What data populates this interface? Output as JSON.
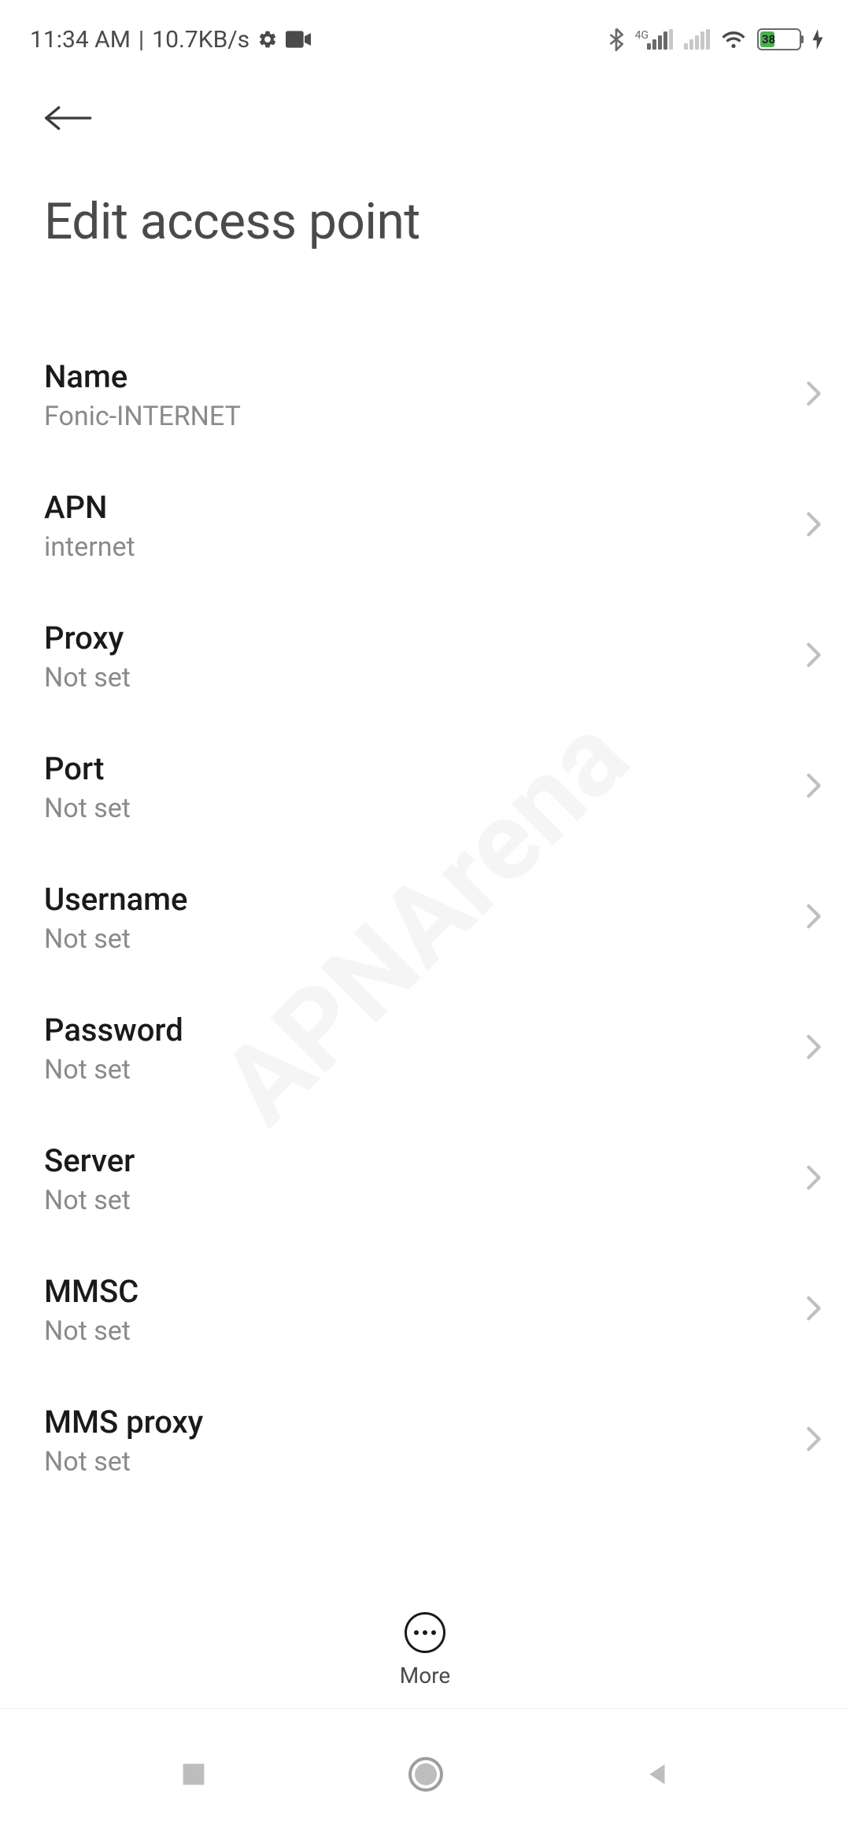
{
  "status_bar": {
    "time": "11:34 AM",
    "speed": "10.7KB/s",
    "signal_label": "4G",
    "battery_pct": "38"
  },
  "page": {
    "title": "Edit access point",
    "more_label": "More"
  },
  "settings": [
    {
      "label": "Name",
      "value": "Fonic-INTERNET"
    },
    {
      "label": "APN",
      "value": "internet"
    },
    {
      "label": "Proxy",
      "value": "Not set"
    },
    {
      "label": "Port",
      "value": "Not set"
    },
    {
      "label": "Username",
      "value": "Not set"
    },
    {
      "label": "Password",
      "value": "Not set"
    },
    {
      "label": "Server",
      "value": "Not set"
    },
    {
      "label": "MMSC",
      "value": "Not set"
    },
    {
      "label": "MMS proxy",
      "value": "Not set"
    }
  ]
}
